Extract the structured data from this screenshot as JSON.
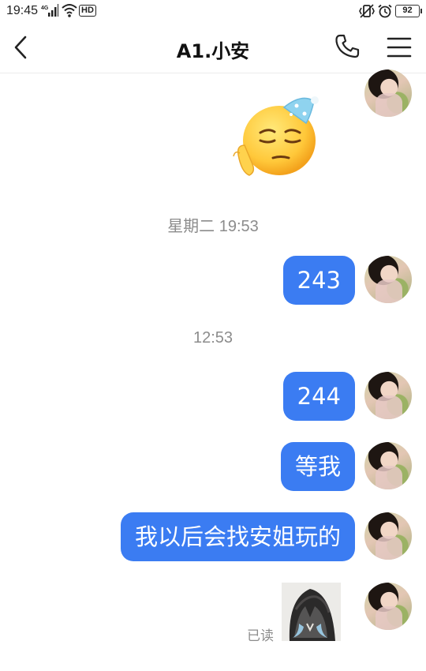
{
  "status_bar": {
    "time": "19:45",
    "network": "4G",
    "hd": "HD",
    "battery": "92"
  },
  "header": {
    "title": "A1.小安",
    "icons": [
      "back-icon",
      "phone-icon",
      "menu-icon"
    ]
  },
  "chat": {
    "timestamps": [
      "星期二 19:53",
      "12:53"
    ],
    "messages": [
      {
        "type": "sticker",
        "icon": "sleepy-emoji-sticker"
      },
      {
        "type": "text",
        "text": "243"
      },
      {
        "type": "text",
        "text": "244"
      },
      {
        "type": "text",
        "text": "等我"
      },
      {
        "type": "text",
        "text": "我以后会找安姐玩的"
      },
      {
        "type": "image",
        "status": "已读"
      }
    ]
  },
  "colors": {
    "bubble": "#3b7cf2",
    "timestamp": "#8c8c8c"
  }
}
